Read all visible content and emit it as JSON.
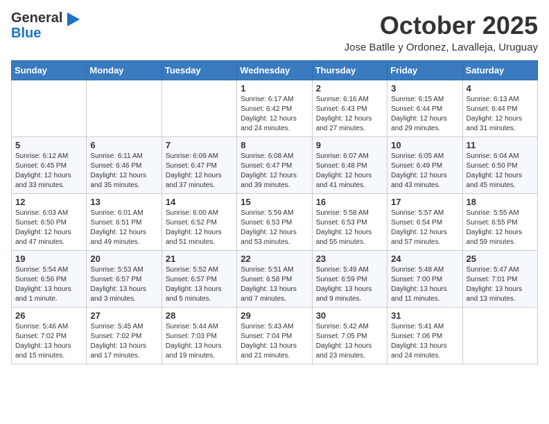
{
  "logo": {
    "general": "General",
    "blue": "Blue"
  },
  "header": {
    "month": "October 2025",
    "location": "Jose Batlle y Ordonez, Lavalleja, Uruguay"
  },
  "weekdays": [
    "Sunday",
    "Monday",
    "Tuesday",
    "Wednesday",
    "Thursday",
    "Friday",
    "Saturday"
  ],
  "weeks": [
    [
      {
        "day": "",
        "info": ""
      },
      {
        "day": "",
        "info": ""
      },
      {
        "day": "",
        "info": ""
      },
      {
        "day": "1",
        "info": "Sunrise: 6:17 AM\nSunset: 6:42 PM\nDaylight: 12 hours and 24 minutes."
      },
      {
        "day": "2",
        "info": "Sunrise: 6:16 AM\nSunset: 6:43 PM\nDaylight: 12 hours and 27 minutes."
      },
      {
        "day": "3",
        "info": "Sunrise: 6:15 AM\nSunset: 6:44 PM\nDaylight: 12 hours and 29 minutes."
      },
      {
        "day": "4",
        "info": "Sunrise: 6:13 AM\nSunset: 6:44 PM\nDaylight: 12 hours and 31 minutes."
      }
    ],
    [
      {
        "day": "5",
        "info": "Sunrise: 6:12 AM\nSunset: 6:45 PM\nDaylight: 12 hours and 33 minutes."
      },
      {
        "day": "6",
        "info": "Sunrise: 6:11 AM\nSunset: 6:46 PM\nDaylight: 12 hours and 35 minutes."
      },
      {
        "day": "7",
        "info": "Sunrise: 6:09 AM\nSunset: 6:47 PM\nDaylight: 12 hours and 37 minutes."
      },
      {
        "day": "8",
        "info": "Sunrise: 6:08 AM\nSunset: 6:47 PM\nDaylight: 12 hours and 39 minutes."
      },
      {
        "day": "9",
        "info": "Sunrise: 6:07 AM\nSunset: 6:48 PM\nDaylight: 12 hours and 41 minutes."
      },
      {
        "day": "10",
        "info": "Sunrise: 6:05 AM\nSunset: 6:49 PM\nDaylight: 12 hours and 43 minutes."
      },
      {
        "day": "11",
        "info": "Sunrise: 6:04 AM\nSunset: 6:50 PM\nDaylight: 12 hours and 45 minutes."
      }
    ],
    [
      {
        "day": "12",
        "info": "Sunrise: 6:03 AM\nSunset: 6:50 PM\nDaylight: 12 hours and 47 minutes."
      },
      {
        "day": "13",
        "info": "Sunrise: 6:01 AM\nSunset: 6:51 PM\nDaylight: 12 hours and 49 minutes."
      },
      {
        "day": "14",
        "info": "Sunrise: 6:00 AM\nSunset: 6:52 PM\nDaylight: 12 hours and 51 minutes."
      },
      {
        "day": "15",
        "info": "Sunrise: 5:59 AM\nSunset: 6:53 PM\nDaylight: 12 hours and 53 minutes."
      },
      {
        "day": "16",
        "info": "Sunrise: 5:58 AM\nSunset: 6:53 PM\nDaylight: 12 hours and 55 minutes."
      },
      {
        "day": "17",
        "info": "Sunrise: 5:57 AM\nSunset: 6:54 PM\nDaylight: 12 hours and 57 minutes."
      },
      {
        "day": "18",
        "info": "Sunrise: 5:55 AM\nSunset: 6:55 PM\nDaylight: 12 hours and 59 minutes."
      }
    ],
    [
      {
        "day": "19",
        "info": "Sunrise: 5:54 AM\nSunset: 6:56 PM\nDaylight: 13 hours and 1 minute."
      },
      {
        "day": "20",
        "info": "Sunrise: 5:53 AM\nSunset: 6:57 PM\nDaylight: 13 hours and 3 minutes."
      },
      {
        "day": "21",
        "info": "Sunrise: 5:52 AM\nSunset: 6:57 PM\nDaylight: 13 hours and 5 minutes."
      },
      {
        "day": "22",
        "info": "Sunrise: 5:51 AM\nSunset: 6:58 PM\nDaylight: 13 hours and 7 minutes."
      },
      {
        "day": "23",
        "info": "Sunrise: 5:49 AM\nSunset: 6:59 PM\nDaylight: 13 hours and 9 minutes."
      },
      {
        "day": "24",
        "info": "Sunrise: 5:48 AM\nSunset: 7:00 PM\nDaylight: 13 hours and 11 minutes."
      },
      {
        "day": "25",
        "info": "Sunrise: 5:47 AM\nSunset: 7:01 PM\nDaylight: 13 hours and 13 minutes."
      }
    ],
    [
      {
        "day": "26",
        "info": "Sunrise: 5:46 AM\nSunset: 7:02 PM\nDaylight: 13 hours and 15 minutes."
      },
      {
        "day": "27",
        "info": "Sunrise: 5:45 AM\nSunset: 7:02 PM\nDaylight: 13 hours and 17 minutes."
      },
      {
        "day": "28",
        "info": "Sunrise: 5:44 AM\nSunset: 7:03 PM\nDaylight: 13 hours and 19 minutes."
      },
      {
        "day": "29",
        "info": "Sunrise: 5:43 AM\nSunset: 7:04 PM\nDaylight: 13 hours and 21 minutes."
      },
      {
        "day": "30",
        "info": "Sunrise: 5:42 AM\nSunset: 7:05 PM\nDaylight: 13 hours and 23 minutes."
      },
      {
        "day": "31",
        "info": "Sunrise: 5:41 AM\nSunset: 7:06 PM\nDaylight: 13 hours and 24 minutes."
      },
      {
        "day": "",
        "info": ""
      }
    ]
  ]
}
